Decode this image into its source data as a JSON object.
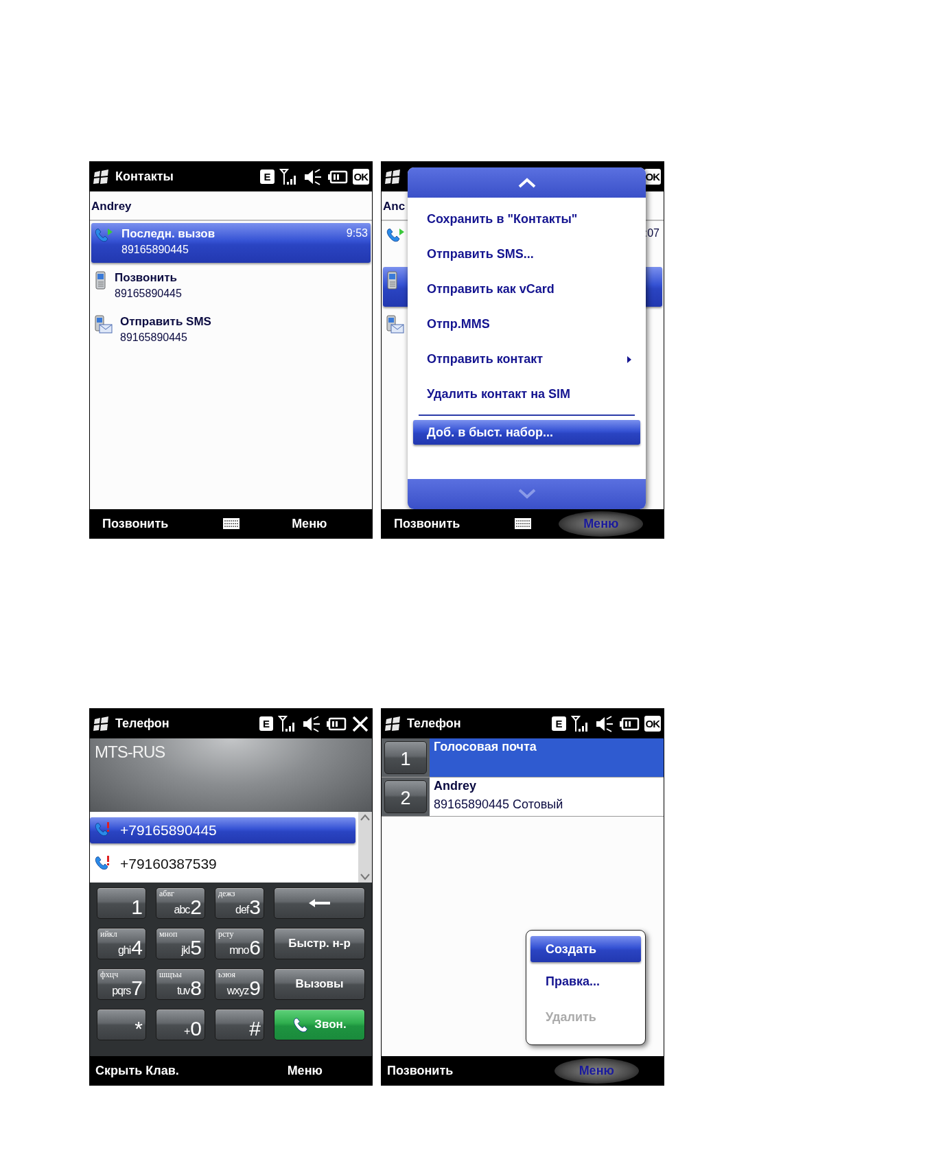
{
  "screens": [
    {
      "kind": "contact",
      "status": {
        "title": "Контакты",
        "indicators": [
          {
            "kind": "network",
            "label": "E"
          },
          {
            "kind": "signal"
          },
          {
            "kind": "muted"
          },
          {
            "kind": "battery"
          }
        ],
        "right_button": {
          "kind": "ok",
          "label": "OK"
        }
      },
      "header": "Andrey",
      "items": [
        {
          "kind": "call",
          "title": "Последн. вызов",
          "number": "89165890445",
          "time": "9:53",
          "selected": true
        },
        {
          "kind": "phone",
          "title": "Позвонить",
          "number": "89165890445",
          "selected": false
        },
        {
          "kind": "sms",
          "title": "Отправить SMS",
          "number": "89165890445",
          "selected": false
        }
      ],
      "softkeys": {
        "left": "Позвонить",
        "keyboard": true,
        "right": "Меню",
        "right_active": false
      }
    },
    {
      "kind": "contact",
      "status": {
        "right_button": {
          "kind": "ok",
          "label": "OK"
        }
      },
      "header": "Anc",
      "items": [
        {
          "kind": "call",
          "time": ":07",
          "selected": false
        },
        {
          "kind": "phone",
          "selected": true
        },
        {
          "kind": "sms",
          "selected": false
        }
      ],
      "menu": {
        "items": [
          {
            "kind": "item",
            "label": "Сохранить в \"Контакты\"",
            "submenu": false,
            "selected": false
          },
          {
            "kind": "item",
            "label": "Отправить SMS...",
            "submenu": false,
            "selected": false
          },
          {
            "kind": "item",
            "label": "Отправить как vCard",
            "submenu": false,
            "selected": false
          },
          {
            "kind": "item",
            "label": "Отпр.MMS",
            "submenu": false,
            "selected": false
          },
          {
            "kind": "item",
            "label": "Отправить контакт",
            "submenu": true,
            "selected": false
          },
          {
            "kind": "item",
            "label": "Удалить контакт на SIM",
            "submenu": false,
            "selected": false
          },
          {
            "kind": "separator"
          },
          {
            "kind": "item",
            "label": "Доб. в быст. набор...",
            "submenu": false,
            "selected": true
          }
        ]
      },
      "softkeys": {
        "left": "Позвонить",
        "keyboard": true,
        "right": "Меню",
        "right_active": true
      }
    },
    {
      "kind": "dialer",
      "status": {
        "title": "Телефон",
        "indicators": [
          {
            "kind": "network",
            "label": "E"
          },
          {
            "kind": "signal"
          },
          {
            "kind": "muted"
          },
          {
            "kind": "battery"
          }
        ],
        "right_button": {
          "kind": "close"
        }
      },
      "carrier": "MTS-RUS",
      "calls": [
        {
          "number": "+79165890445",
          "selected": true
        },
        {
          "number": "+79160387539",
          "selected": false
        }
      ],
      "keys": [
        {
          "kind": "digit",
          "digit": "1"
        },
        {
          "kind": "digit",
          "cyr": "абвг",
          "lat": "abc",
          "digit": "2"
        },
        {
          "kind": "digit",
          "cyr": "дежз",
          "lat": "def",
          "digit": "3"
        },
        {
          "kind": "backspace"
        },
        {
          "kind": "digit",
          "cyr": "ийкл",
          "lat": "ghi",
          "digit": "4"
        },
        {
          "kind": "digit",
          "cyr": "мноп",
          "lat": "jkl",
          "digit": "5"
        },
        {
          "kind": "digit",
          "cyr": "рсту",
          "lat": "mno",
          "digit": "6"
        },
        {
          "kind": "action",
          "label": "Быстр. н-р"
        },
        {
          "kind": "digit",
          "cyr": "фхцч",
          "lat": "pqrs",
          "digit": "7"
        },
        {
          "kind": "digit",
          "cyr": "шщъы",
          "lat": "tuv",
          "digit": "8"
        },
        {
          "kind": "digit",
          "cyr": "ьэюя",
          "lat": "wxyz",
          "digit": "9"
        },
        {
          "kind": "action",
          "label": "Вызовы"
        },
        {
          "kind": "digit",
          "digit": "*"
        },
        {
          "kind": "digit",
          "lat": "+",
          "digit": "0"
        },
        {
          "kind": "digit",
          "digit": "#"
        },
        {
          "kind": "call",
          "label": "Звон."
        }
      ],
      "softkeys": {
        "left": "Скрыть Клав.",
        "keyboard": false,
        "right": "Меню",
        "right_active": false
      }
    },
    {
      "kind": "speed_dial",
      "status": {
        "title": "Телефон",
        "indicators": [
          {
            "kind": "network",
            "label": "E"
          },
          {
            "kind": "signal"
          },
          {
            "kind": "muted"
          },
          {
            "kind": "battery"
          }
        ],
        "right_button": {
          "kind": "ok",
          "label": "OK"
        }
      },
      "entries": [
        {
          "slot": "1",
          "name": "Голосовая почта",
          "selected": true
        },
        {
          "slot": "2",
          "name": "Andrey",
          "detail": "89165890445 Сотовый",
          "selected": false
        }
      ],
      "popup": {
        "items": [
          {
            "label": "Создать",
            "selected": true,
            "disabled": false
          },
          {
            "label": "Правка...",
            "selected": false,
            "disabled": false
          },
          {
            "label": "Удалить",
            "selected": false,
            "disabled": true
          }
        ]
      },
      "softkeys": {
        "left": "Позвонить",
        "keyboard": false,
        "right": "Меню",
        "right_active": true
      }
    }
  ]
}
